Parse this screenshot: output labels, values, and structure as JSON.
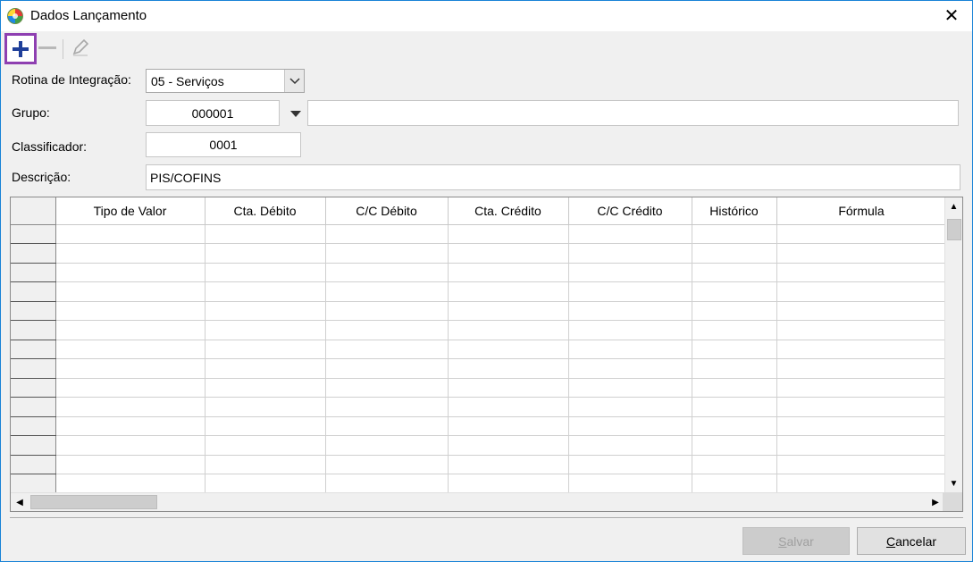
{
  "window": {
    "title": "Dados Lançamento",
    "close_glyph": "✕"
  },
  "toolbar": {
    "add_icon": "plus-icon",
    "remove_icon": "minus-icon",
    "edit_icon": "pencil-icon"
  },
  "form": {
    "rotina_label": "Rotina de Integração:",
    "rotina_value": "05 - Serviços",
    "grupo_label": "Grupo:",
    "grupo_value": "000001",
    "grupo_desc": "",
    "classificador_label": "Classificador:",
    "classificador_value": "0001",
    "descricao_label": "Descrição:",
    "descricao_value": "PIS/COFINS"
  },
  "grid": {
    "columns": [
      "Tipo de Valor",
      "Cta. Débito",
      "C/C Débito",
      "Cta. Crédito",
      "C/C Crédito",
      "Histórico",
      "Fórmula"
    ],
    "rows": [
      [
        "",
        "",
        "",
        "",
        "",
        "",
        ""
      ],
      [
        "",
        "",
        "",
        "",
        "",
        "",
        ""
      ],
      [
        "",
        "",
        "",
        "",
        "",
        "",
        ""
      ],
      [
        "",
        "",
        "",
        "",
        "",
        "",
        ""
      ],
      [
        "",
        "",
        "",
        "",
        "",
        "",
        ""
      ],
      [
        "",
        "",
        "",
        "",
        "",
        "",
        ""
      ],
      [
        "",
        "",
        "",
        "",
        "",
        "",
        ""
      ],
      [
        "",
        "",
        "",
        "",
        "",
        "",
        ""
      ],
      [
        "",
        "",
        "",
        "",
        "",
        "",
        ""
      ],
      [
        "",
        "",
        "",
        "",
        "",
        "",
        ""
      ],
      [
        "",
        "",
        "",
        "",
        "",
        "",
        ""
      ],
      [
        "",
        "",
        "",
        "",
        "",
        "",
        ""
      ],
      [
        "",
        "",
        "",
        "",
        "",
        "",
        ""
      ],
      [
        "",
        "",
        "",
        "",
        "",
        "",
        ""
      ]
    ]
  },
  "buttons": {
    "salvar_first": "S",
    "salvar_rest": "alvar",
    "cancelar_first": "C",
    "cancelar_rest": "ancelar"
  },
  "colors": {
    "highlight": "#8e3fb1",
    "accent": "#1f3f9a",
    "window_border": "#1883d7"
  }
}
